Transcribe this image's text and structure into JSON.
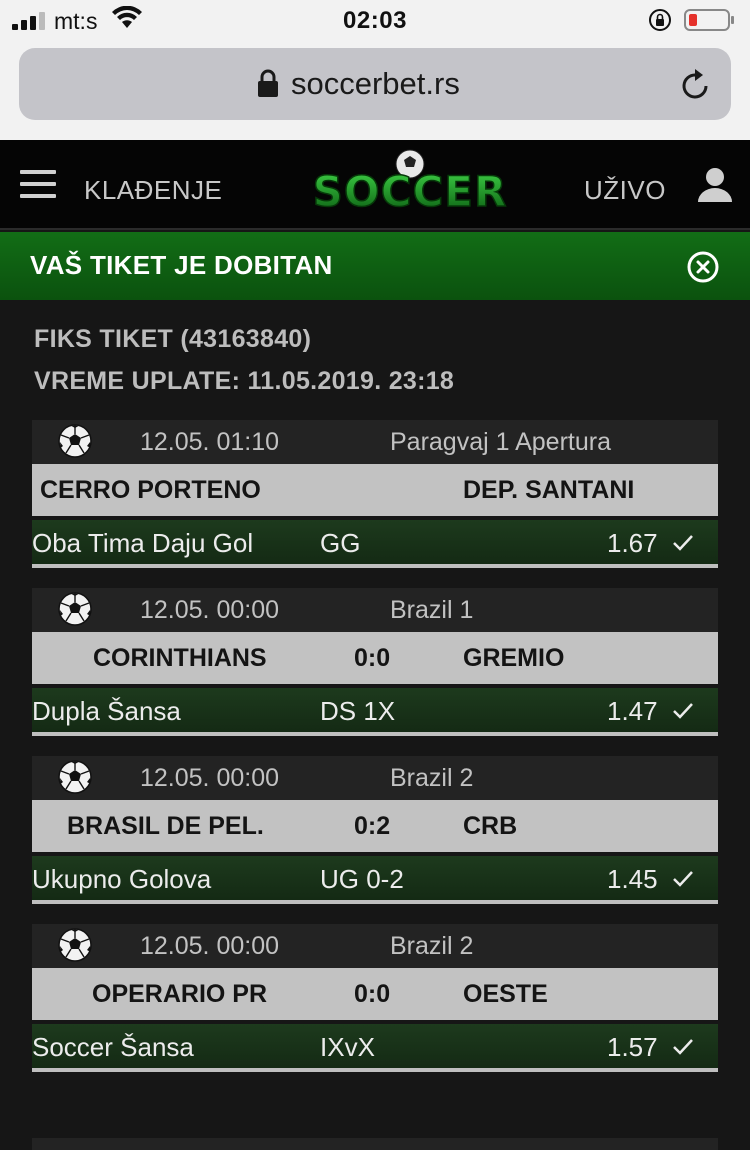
{
  "status_bar": {
    "carrier": "mt:s",
    "time": "02:03",
    "signal_icon": "signal-bars-icon",
    "wifi_icon": "wifi-icon",
    "orientation_lock_icon": "orientation-lock-icon",
    "battery_icon": "battery-low-icon",
    "battery_color": "#e5312b"
  },
  "browser": {
    "url": "soccerbet.rs",
    "lock_icon": "lock-icon",
    "reload_icon": "reload-icon"
  },
  "nav": {
    "menu_icon": "hamburger-icon",
    "betting_label": "KLAĐENJE",
    "logo_text": "SOCCER",
    "live_label": "UŽIVO",
    "user_icon": "user-icon"
  },
  "banner": {
    "title": "VAŠ TIKET JE DOBITAN",
    "close_icon": "close-circle-icon",
    "color": "#126d16"
  },
  "ticket": {
    "title": "FIKS TIKET (43163840)",
    "payment_time": "VREME UPLATE: 11.05.2019. 23:18"
  },
  "matches": [
    {
      "sport_icon": "soccer-ball-icon",
      "datetime": "12.05. 01:10",
      "league": "Paragvaj 1 Apertura",
      "home": "CERRO PORTENO",
      "score": "",
      "away": "DEP. SANTANI",
      "bet_name": "Oba Tima Daju Gol",
      "bet_code": "GG",
      "odd": "1.67",
      "status_icon": "check-icon"
    },
    {
      "sport_icon": "soccer-ball-icon",
      "datetime": "12.05. 00:00",
      "league": "Brazil 1",
      "home": "CORINTHIANS",
      "score": "0:0",
      "away": "GREMIO",
      "bet_name": "Dupla Šansa",
      "bet_code": "DS 1X",
      "odd": "1.47",
      "status_icon": "check-icon"
    },
    {
      "sport_icon": "soccer-ball-icon",
      "datetime": "12.05. 00:00",
      "league": "Brazil 2",
      "home": "BRASIL DE PEL.",
      "score": "0:2",
      "away": "CRB",
      "bet_name": "Ukupno Golova",
      "bet_code": "UG 0-2",
      "odd": "1.45",
      "status_icon": "check-icon"
    },
    {
      "sport_icon": "soccer-ball-icon",
      "datetime": "12.05. 00:00",
      "league": "Brazil 2",
      "home": "OPERARIO PR",
      "score": "0:0",
      "away": "OESTE",
      "bet_name": "Soccer Šansa",
      "bet_code": "IXvX",
      "odd": "1.57",
      "status_icon": "check-icon"
    }
  ]
}
